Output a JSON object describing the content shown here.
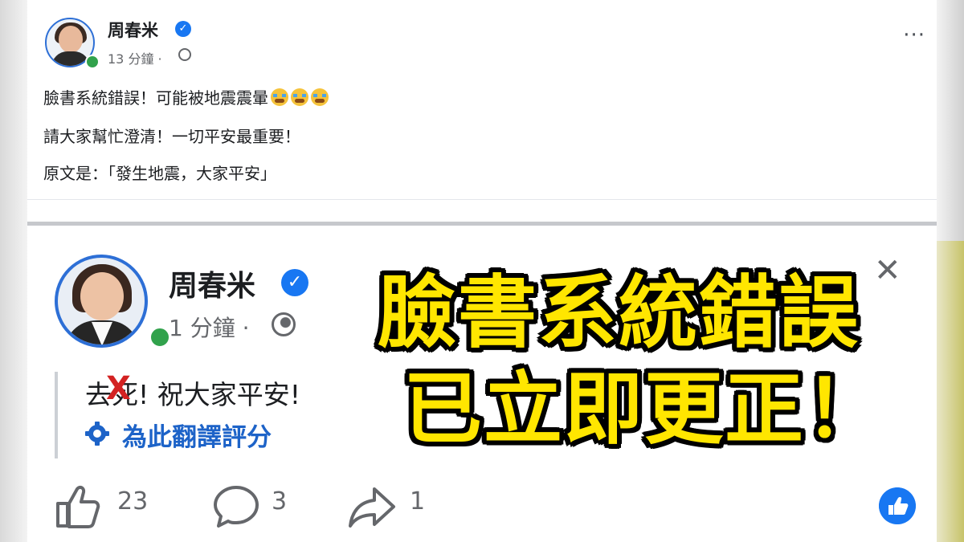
{
  "top_post": {
    "author": "周春米",
    "time": "13 分鐘",
    "dot": "·",
    "more": "···",
    "lines": [
      "臉書系統錯誤！可能被地震震暈",
      "請大家幫忙澄清！一切平安最重要！",
      "原文是：「發生地震，大家平安」"
    ]
  },
  "bottom_post": {
    "author": "周春米",
    "time": "1 分鐘",
    "dot": "·",
    "close": "✕",
    "text_strike": "去死",
    "text_rest": "! 祝大家平安!",
    "x_mark": "X",
    "translate_label": "為此翻譯評分",
    "likes": "23",
    "comments": "3",
    "shares": "1"
  },
  "overlay": {
    "line1": "臉書系統錯誤",
    "line2": "已立即更正！"
  },
  "colors": {
    "facebook_blue": "#1877f2",
    "overlay_yellow": "#ffe600",
    "online_green": "#31a24c"
  }
}
